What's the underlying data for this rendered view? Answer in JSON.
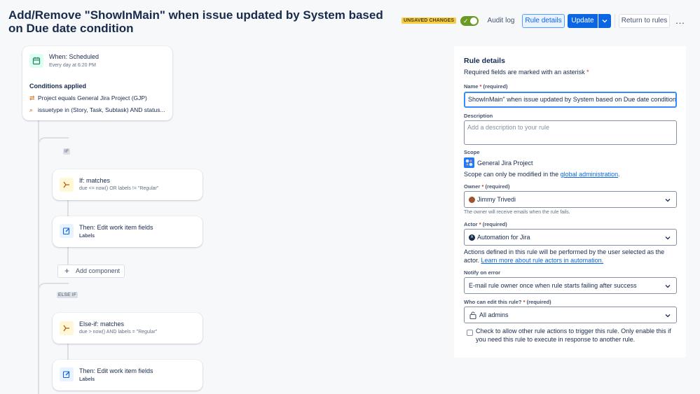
{
  "header": {
    "title": "Add/Remove \"ShowInMain\" when issue updated by System based on Due date condition",
    "unsaved_badge": "UNSAVED CHANGES",
    "audit_log": "Audit log",
    "rule_details": "Rule details",
    "update": "Update",
    "return_to_rules": "Return to rules",
    "more": "…"
  },
  "canvas": {
    "trigger": {
      "title": "When: Scheduled",
      "subtitle": "Every day at 6:20 PM",
      "conditions_heading": "Conditions applied",
      "conditions": [
        "Project equals General Jira Project (GJP)",
        "issuetype in (Story, Task, Subtask) AND status..."
      ]
    },
    "if_tag": "IF",
    "else_if_tag": "ELSE IF",
    "if_block": {
      "title": "If: matches",
      "subtitle": "due <= now() OR labels != \"Regular\""
    },
    "then_block_1": {
      "title": "Then: Edit work item fields",
      "subtitle": "Labels"
    },
    "add_component": "Add component",
    "else_if_block": {
      "title": "Else-if: matches",
      "subtitle": "due > now() AND labels = \"Regular\""
    },
    "then_block_2": {
      "title": "Then: Edit work item fields",
      "subtitle": "Labels"
    }
  },
  "panel": {
    "title": "Rule details",
    "required_note": "Required fields are marked with an asterisk",
    "asterisk": "*",
    "name_label": "Name",
    "required_text": "(required)",
    "name_value": "ShowInMain\" when issue updated by System based on Due date condition",
    "description_label": "Description",
    "description_placeholder": "Add a description to your rule",
    "scope_label": "Scope",
    "scope_project": "General Jira Project",
    "scope_note_prefix": "Scope can only be modified in the ",
    "scope_note_link": "global administration",
    "scope_note_suffix": ".",
    "owner_label": "Owner",
    "owner_value": "Jimmy Trivedi",
    "owner_helper": "The owner will receive emails when the rule fails.",
    "actor_label": "Actor",
    "actor_value": "Automation for Jira",
    "actor_note": "Actions defined in this rule will be performed by the user selected as the actor.",
    "actor_link": "Learn more about rule actors in automation.",
    "notify_label": "Notify on error",
    "notify_value": "E-mail rule owner once when rule starts failing after success",
    "edit_label": "Who can edit this rule?",
    "edit_value": "All admins",
    "checkbox_label": "Check to allow other rule actions to trigger this rule. Only enable this if you need this rule to execute in response to another rule."
  },
  "colors": {
    "accent": "#0c66e4",
    "toggle_on": "#6a9a23",
    "unsaved_badge": "#f5cd47",
    "required": "#c9372c"
  }
}
